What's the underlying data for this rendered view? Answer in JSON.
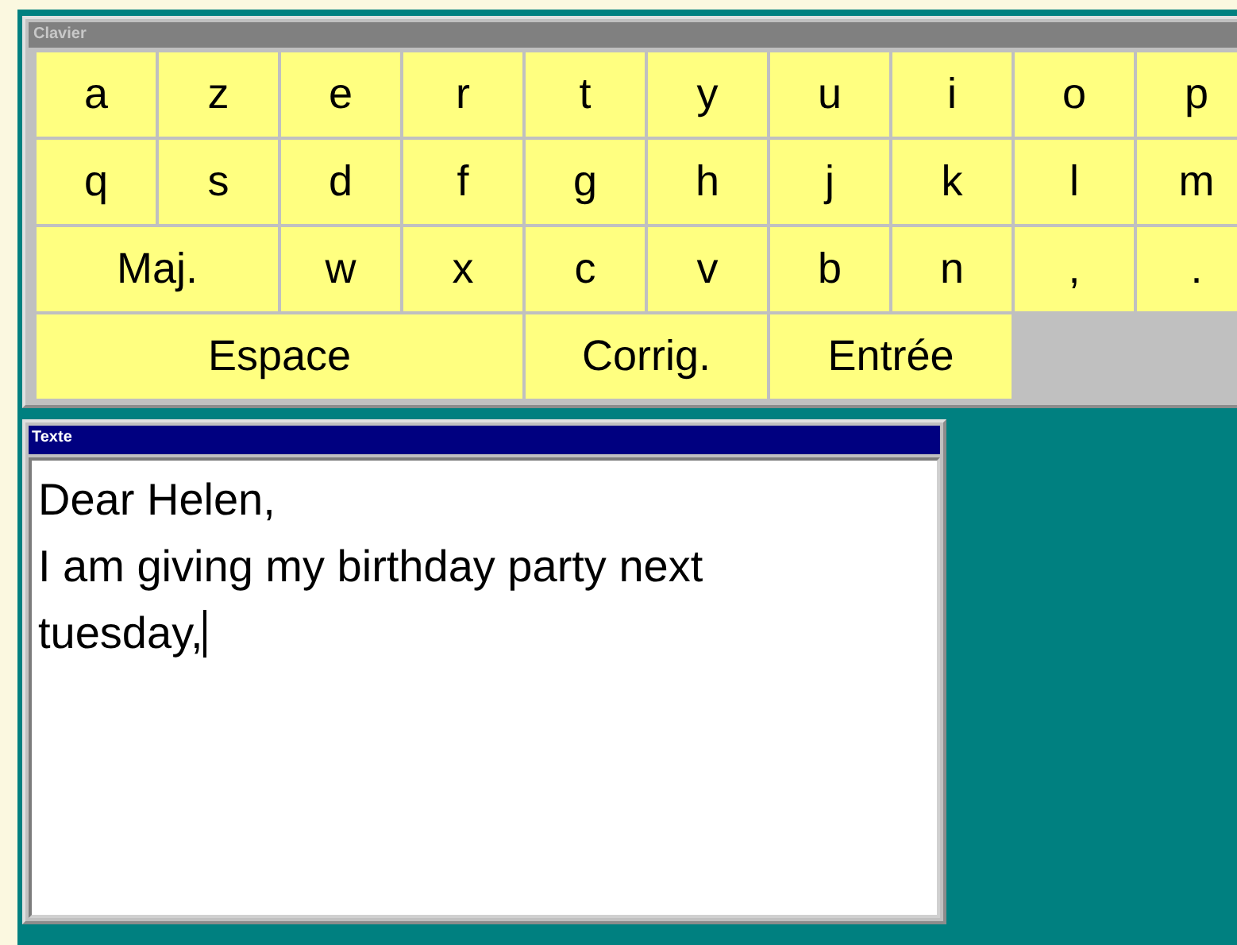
{
  "keyboard_window": {
    "title": "Clavier",
    "rows": [
      {
        "keys": [
          {
            "label": "a",
            "kind": "char"
          },
          {
            "label": "z",
            "kind": "char"
          },
          {
            "label": "e",
            "kind": "char"
          },
          {
            "label": "r",
            "kind": "char"
          },
          {
            "label": "t",
            "kind": "char"
          },
          {
            "label": "y",
            "kind": "char"
          },
          {
            "label": "u",
            "kind": "char"
          },
          {
            "label": "i",
            "kind": "char"
          },
          {
            "label": "o",
            "kind": "char"
          },
          {
            "label": "p",
            "kind": "char"
          }
        ]
      },
      {
        "keys": [
          {
            "label": "q",
            "kind": "char"
          },
          {
            "label": "s",
            "kind": "char"
          },
          {
            "label": "d",
            "kind": "char"
          },
          {
            "label": "f",
            "kind": "char"
          },
          {
            "label": "g",
            "kind": "char"
          },
          {
            "label": "h",
            "kind": "char"
          },
          {
            "label": "j",
            "kind": "char"
          },
          {
            "label": "k",
            "kind": "char"
          },
          {
            "label": "l",
            "kind": "char"
          },
          {
            "label": "m",
            "kind": "char"
          }
        ]
      },
      {
        "keys": [
          {
            "label": "Maj.",
            "kind": "command"
          },
          {
            "label": "w",
            "kind": "char"
          },
          {
            "label": "x",
            "kind": "char"
          },
          {
            "label": "c",
            "kind": "char"
          },
          {
            "label": "v",
            "kind": "char"
          },
          {
            "label": "b",
            "kind": "char"
          },
          {
            "label": "n",
            "kind": "char"
          },
          {
            "label": ",",
            "kind": "char"
          },
          {
            "label": ".",
            "kind": "char"
          }
        ]
      },
      {
        "keys": [
          {
            "label": "Espace",
            "kind": "space"
          },
          {
            "label": "Corrig.",
            "kind": "command"
          },
          {
            "label": "Entrée",
            "kind": "command"
          }
        ]
      }
    ]
  },
  "text_window": {
    "title": "Texte",
    "lines": [
      "Dear Helen,",
      "I am giving my birthday party next",
      "tuesday,"
    ]
  }
}
